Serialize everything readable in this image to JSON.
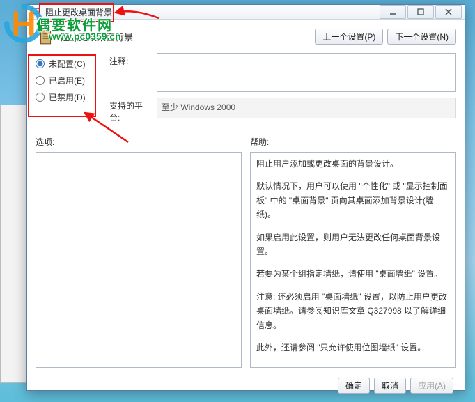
{
  "window": {
    "title": "阻止更改桌面背景"
  },
  "header": {
    "policy_title": "阻止更改桌面背景",
    "prev_btn": "上一个设置(P)",
    "next_btn": "下一个设置(N)"
  },
  "radios": {
    "not_configured": "未配置(C)",
    "enabled": "已启用(E)",
    "disabled": "已禁用(D)"
  },
  "labels": {
    "comment": "注释:",
    "supported": "支持的平台:",
    "options": "选项:",
    "help": "帮助:"
  },
  "supported_text": "至少 Windows 2000",
  "help_text": {
    "p1": "阻止用户添加或更改桌面的背景设计。",
    "p2": "默认情况下，用户可以使用 \"个性化\" 或 \"显示控制面板\" 中的 \"桌面背景\" 页向其桌面添加背景设计(墙纸)。",
    "p3": "如果启用此设置，则用户无法更改任何桌面背景设置。",
    "p4": "若要为某个组指定墙纸，请使用 \"桌面墙纸\" 设置。",
    "p5": "注意: 还必须启用 \"桌面墙纸\" 设置，以防止用户更改桌面墙纸。请参阅知识库文章 Q327998 以了解详细信息。",
    "p6": "此外，还请参阅 \"只允许使用位图墙纸\" 设置。"
  },
  "footer": {
    "ok": "确定",
    "cancel": "取消",
    "apply": "应用(A)"
  },
  "watermark": {
    "text": "偶要软件网",
    "url": "www.pc0359.cn"
  }
}
